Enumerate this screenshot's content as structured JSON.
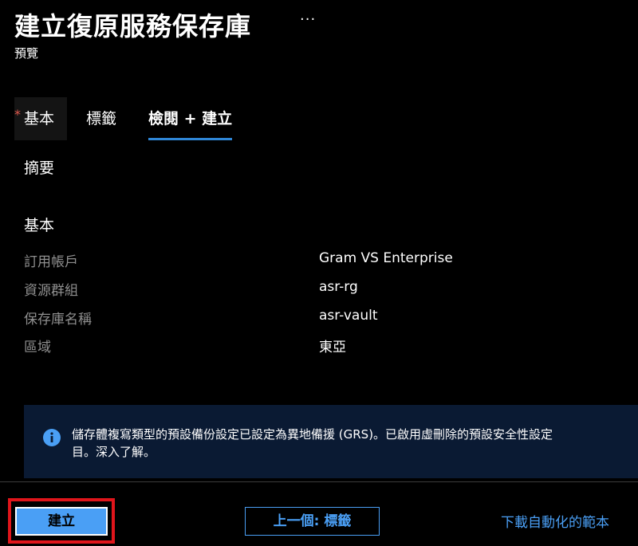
{
  "header": {
    "title": "建立復原服務保存庫",
    "more_label": "···",
    "subtitle": "預覽"
  },
  "tabs": [
    {
      "label": "基本",
      "required_marker": "*"
    },
    {
      "label": "標籤"
    },
    {
      "label": "檢閱 + 建立",
      "active": true
    }
  ],
  "summary": {
    "heading": "摘要",
    "basics_heading": "基本",
    "rows": [
      {
        "label": "訂用帳戶",
        "value": "Gram VS Enterprise"
      },
      {
        "label": "資源群組",
        "value": "asr-rg"
      },
      {
        "label": "保存庫名稱",
        "value": "asr-vault"
      },
      {
        "label": "區域",
        "value": "東亞"
      }
    ]
  },
  "info": {
    "icon": "info-icon",
    "line1": "儲存體複寫類型的預設備份設定已設定為異地備援 (GRS)。已啟用虛刪除的預設安全性設定",
    "line2": "目。深入了解。"
  },
  "footer": {
    "create_label": "建立",
    "previous_label": "上一個: 標籤",
    "download_label": "下載自動化的範本"
  },
  "colors": {
    "accent": "#4a9ff5",
    "tab_underline": "#2f86d6",
    "info_background": "#0a1a33",
    "highlight": "#e0151b",
    "required": "#e0584c"
  }
}
